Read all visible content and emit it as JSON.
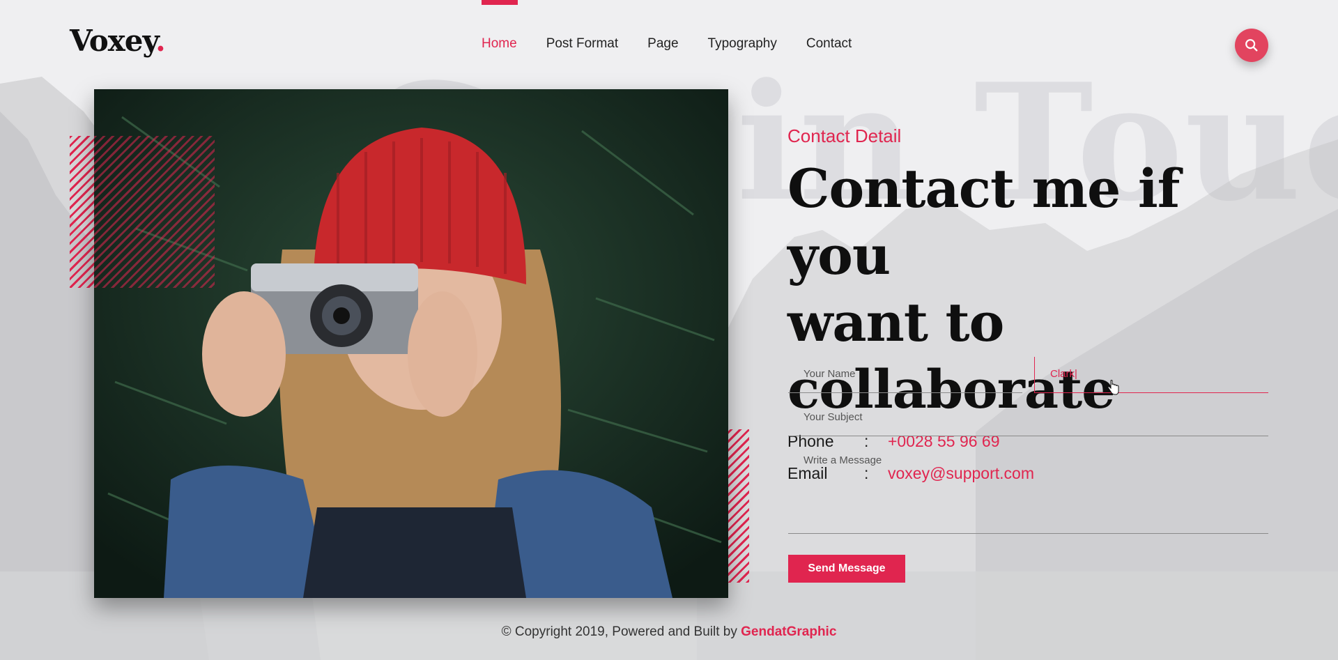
{
  "brand": {
    "name": "Voxey",
    "dot": ".",
    "accent_color": "#e0254f"
  },
  "nav": {
    "items": [
      {
        "label": "Home",
        "active": true
      },
      {
        "label": "Post Format",
        "active": false
      },
      {
        "label": "Page",
        "active": false
      },
      {
        "label": "Typography",
        "active": false
      },
      {
        "label": "Contact",
        "active": false
      }
    ],
    "search_icon": "search-icon"
  },
  "background_watermark": "Get in Touch",
  "contact": {
    "section_label": "Contact Detail",
    "headline_line1": "Contact me if you",
    "headline_line2": "want to collaborate",
    "phone_label": "Phone",
    "phone_value": "+0028 55 96 69",
    "email_label": "Email",
    "email_value": "voxey@support.com",
    "separator": ":"
  },
  "form": {
    "name_placeholder": "Your Name",
    "second_field_value": "Clark|",
    "subject_placeholder": "Your Subject",
    "message_placeholder": "Write a Message",
    "submit_label": "Send Message"
  },
  "footer": {
    "text": "© Copyright 2019, Powered and Built by ",
    "brand": "GendatGraphic"
  }
}
